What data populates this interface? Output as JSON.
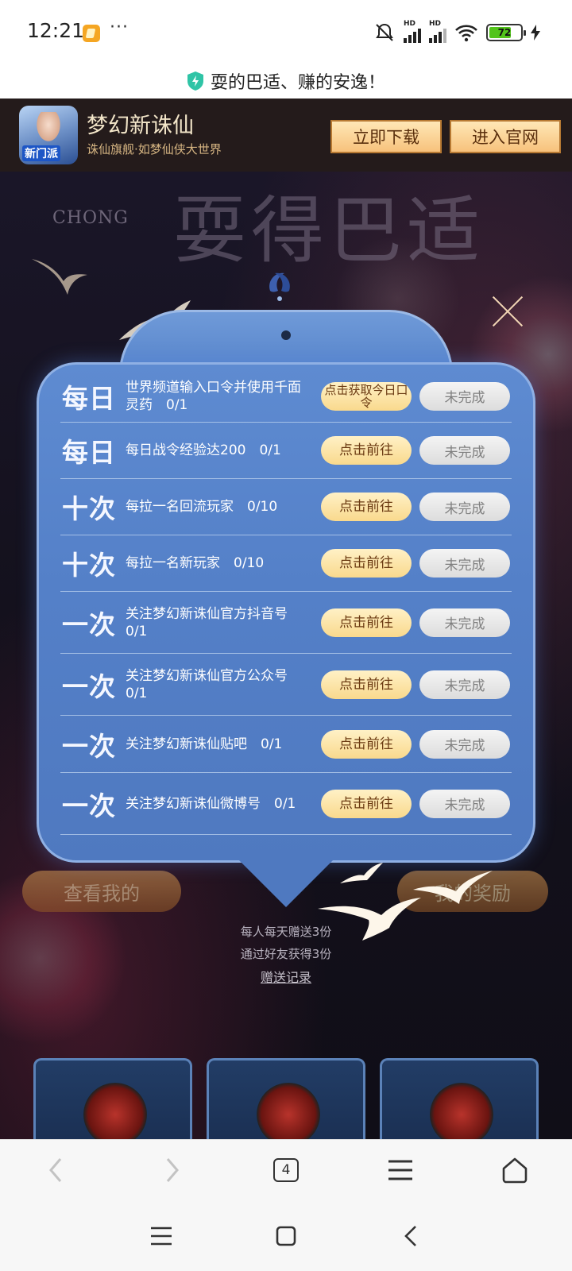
{
  "status_bar": {
    "time": "12:21",
    "more": "···",
    "network_label": "HD",
    "battery_level": "72",
    "battery_fraction": 0.72,
    "battery_color": "#52c41a"
  },
  "site_banner": {
    "text": "耍的巴适、赚的安逸！",
    "icon": "shield-icon"
  },
  "app_bar": {
    "title": "梦幻新诛仙",
    "subtitle": "诛仙旗舰·如梦仙侠大世界",
    "icon_badge": "新门派",
    "download_label": "立即下载",
    "official_label": "进入官网"
  },
  "background": {
    "title": "耍得巴适",
    "subtitle": "CHONG",
    "button_left": "查看我的",
    "button_right": "我的奖励",
    "info_line_1": "每人每天赠送3份",
    "info_line_2": "通过好友获得3份",
    "record_link": "赠送记录"
  },
  "tasks": [
    {
      "freq": "每日",
      "text": "世界频道输入口令并使用千面灵药　0/1",
      "action": "点击获取今日口令",
      "status": "未完成"
    },
    {
      "freq": "每日",
      "text": "每日战令经验达200　0/1",
      "action": "点击前往",
      "status": "未完成"
    },
    {
      "freq": "十次",
      "text": "每拉一名回流玩家　0/10",
      "action": "点击前往",
      "status": "未完成"
    },
    {
      "freq": "十次",
      "text": "每拉一名新玩家　0/10",
      "action": "点击前往",
      "status": "未完成"
    },
    {
      "freq": "一次",
      "text": "关注梦幻新诛仙官方抖音号　0/1",
      "action": "点击前往",
      "status": "未完成"
    },
    {
      "freq": "一次",
      "text": "关注梦幻新诛仙官方公众号　0/1",
      "action": "点击前往",
      "status": "未完成"
    },
    {
      "freq": "一次",
      "text": "关注梦幻新诛仙贴吧　0/1",
      "action": "点击前往",
      "status": "未完成"
    },
    {
      "freq": "一次",
      "text": "关注梦幻新诛仙微博号　0/1",
      "action": "点击前往",
      "status": "未完成"
    }
  ],
  "browser_nav": {
    "tab_count": "4"
  },
  "colors": {
    "modal_blue": "#5480c8",
    "action_gold": "#f9d98d",
    "status_gray": "#dcdcdc",
    "app_bar": "#241b1b"
  }
}
